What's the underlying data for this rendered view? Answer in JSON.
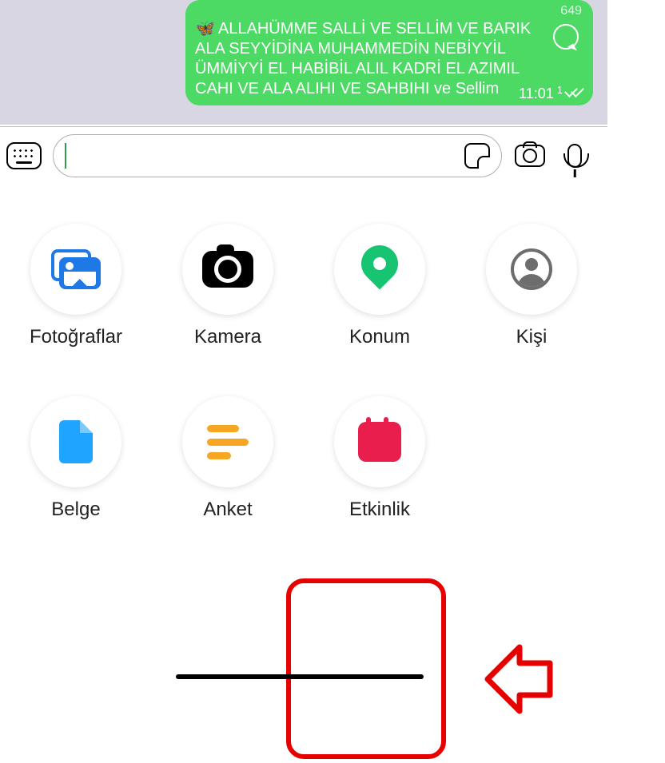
{
  "message": {
    "number": "649",
    "butterfly": "🦋",
    "text": "ALLAHÜMME SALLİ VE SELLİM VE BARIK ALA SEYYİDİNA MUHAMMEDİN NEBİYYİL ÜMMİYYİ EL HABİBİL ALIL KADRİ EL AZIMIL CAHI VE ALA ALIHI VE SAHBIHI ve Sellim",
    "time": "11:01",
    "count": "1"
  },
  "input": {
    "value": ""
  },
  "attachments": {
    "photos": "Fotoğraflar",
    "camera": "Kamera",
    "location": "Konum",
    "contact": "Kişi",
    "document": "Belge",
    "poll": "Anket",
    "event": "Etkinlik"
  }
}
